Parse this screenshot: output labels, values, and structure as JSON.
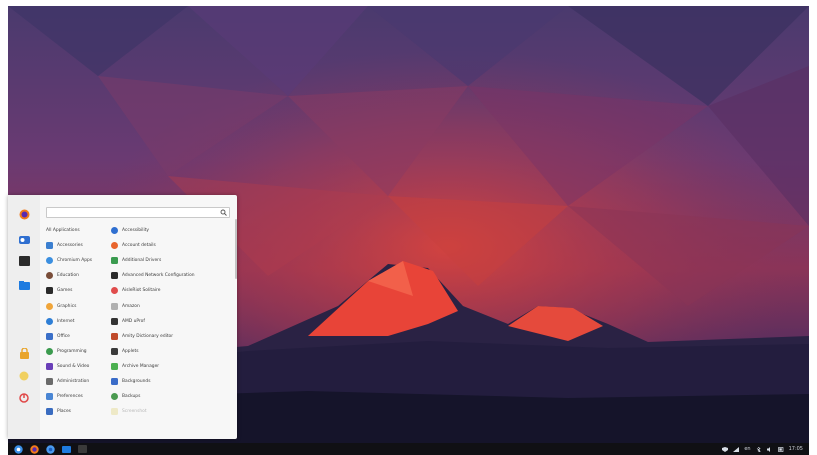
{
  "menu": {
    "search_placeholder": "",
    "categories": [
      {
        "label": "All Applications",
        "icon": "none",
        "color": ""
      },
      {
        "label": "Accessories",
        "icon": "accessories-icon",
        "color": "#3b7fd0"
      },
      {
        "label": "Chromium Apps",
        "icon": "chromium-icon",
        "color": "#3b8fe0"
      },
      {
        "label": "Education",
        "icon": "education-icon",
        "color": "#7a4e3a"
      },
      {
        "label": "Games",
        "icon": "games-icon",
        "color": "#2b2b2b"
      },
      {
        "label": "Graphics",
        "icon": "graphics-icon",
        "color": "#f0a53a"
      },
      {
        "label": "Internet",
        "icon": "internet-icon",
        "color": "#2f7fd6"
      },
      {
        "label": "Office",
        "icon": "office-icon",
        "color": "#3a6fc8"
      },
      {
        "label": "Programming",
        "icon": "programming-icon",
        "color": "#3b9b4f"
      },
      {
        "label": "Sound & Video",
        "icon": "sound-video-icon",
        "color": "#6a3fb8"
      },
      {
        "label": "Administration",
        "icon": "administration-icon",
        "color": "#6b6b6b"
      },
      {
        "label": "Preferences",
        "icon": "preferences-icon",
        "color": "#4a86d4"
      },
      {
        "label": "Places",
        "icon": "places-icon",
        "color": "#3a6cc0"
      }
    ],
    "apps": [
      {
        "label": "Accessibility",
        "icon": "accessibility-icon",
        "color": "#2f6fd0"
      },
      {
        "label": "Account details",
        "icon": "account-details-icon",
        "color": "#e8642c"
      },
      {
        "label": "Additional Drivers",
        "icon": "additional-drivers-icon",
        "color": "#3a9b4f"
      },
      {
        "label": "Advanced Network Configuration",
        "icon": "network-config-icon",
        "color": "#2b2b2b"
      },
      {
        "label": "AisleRiot Solitaire",
        "icon": "solitaire-icon",
        "color": "#e04c4c"
      },
      {
        "label": "Amazon",
        "icon": "amazon-icon",
        "color": "#b0b0b0"
      },
      {
        "label": "AMD uProf",
        "icon": "amd-uprof-icon",
        "color": "#333333"
      },
      {
        "label": "Amity Dictionary editor",
        "icon": "dictionary-editor-icon",
        "color": "#c04a2a"
      },
      {
        "label": "Applets",
        "icon": "applets-icon",
        "color": "#3a3a3a"
      },
      {
        "label": "Archive Manager",
        "icon": "archive-manager-icon",
        "color": "#4cb050"
      },
      {
        "label": "Backgrounds",
        "icon": "backgrounds-icon",
        "color": "#3a6cc8"
      },
      {
        "label": "Backups",
        "icon": "backups-icon",
        "color": "#4a9a50"
      },
      {
        "label": "Screenshot",
        "icon": "screenshot-icon",
        "color": "#e0d070"
      }
    ]
  },
  "sidebar": {
    "items": [
      {
        "name": "firefox-launcher",
        "icon": "firefox-icon"
      },
      {
        "name": "settings-launcher",
        "icon": "settings-toggle-icon"
      },
      {
        "name": "terminal-launcher",
        "icon": "terminal-icon"
      },
      {
        "name": "files-launcher",
        "icon": "folder-icon"
      },
      {
        "name": "lock-screen",
        "icon": "lock-icon"
      },
      {
        "name": "logout",
        "icon": "logout-icon"
      },
      {
        "name": "shutdown",
        "icon": "power-icon"
      }
    ]
  },
  "taskbar": {
    "items": [
      "menu-button-icon",
      "firefox-icon",
      "chromium-icon",
      "files-icon",
      "terminal-icon"
    ],
    "tray": {
      "language": "en",
      "clock": "17:05"
    }
  }
}
